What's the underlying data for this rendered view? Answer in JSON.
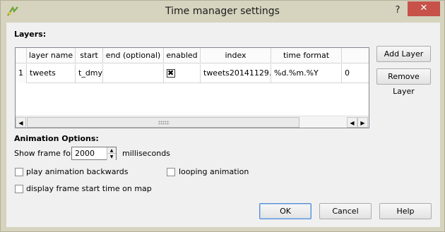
{
  "window": {
    "title": "Time manager settings",
    "help_glyph": "?",
    "close_glyph": "✕"
  },
  "layers": {
    "section_label": "Layers:",
    "columns": [
      "layer name",
      "start",
      "end (optional)",
      "enabled",
      "index",
      "time format",
      "o"
    ],
    "rows": [
      {
        "row_number": "1",
        "layer_name": "tweets",
        "start": "t_dmy",
        "end": "",
        "enabled": true,
        "index": "tweets20141129...",
        "time_format": "%d.%m.%Y",
        "offset": "0"
      }
    ],
    "add_layer_label": "Add Layer",
    "remove_layer_label": "Remove Layer",
    "scroll_left_glyph": "◀",
    "scroll_right_glyph": "▶",
    "scroll_left2_glyph": "◀"
  },
  "animation": {
    "section_label": "Animation Options:",
    "show_frame_label": "Show frame for",
    "show_frame_value": "2000",
    "milliseconds_label": "milliseconds",
    "spin_up_glyph": "▲",
    "spin_down_glyph": "▼",
    "play_backwards_label": "play animation backwards",
    "play_backwards_checked": false,
    "looping_label": "looping animation",
    "looping_checked": false,
    "display_start_time_label": "display frame start time on map",
    "display_start_time_checked": false
  },
  "buttons": {
    "ok_label": "OK",
    "cancel_label": "Cancel",
    "help_label": "Help"
  }
}
